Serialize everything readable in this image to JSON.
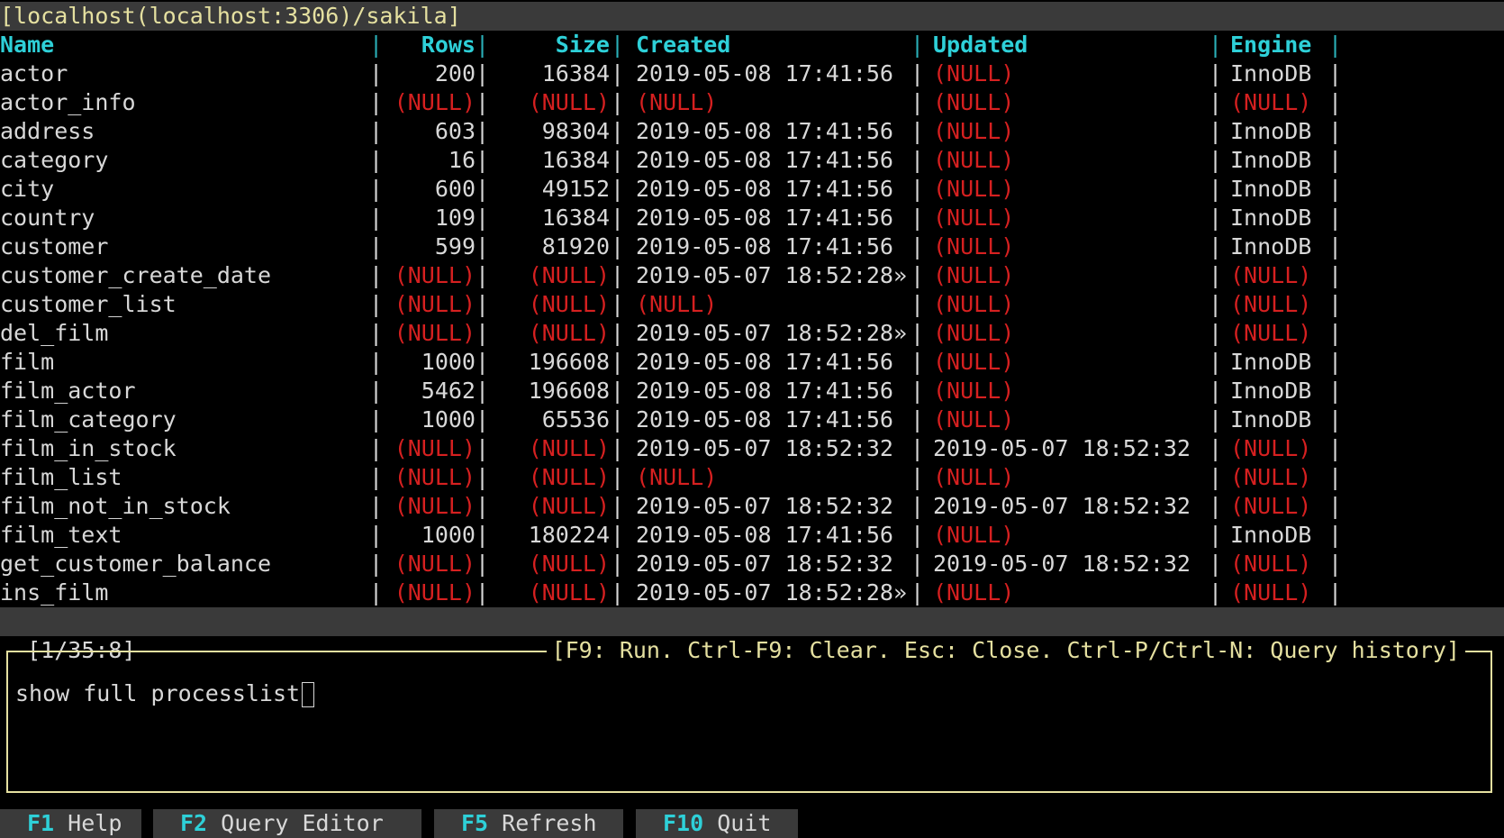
{
  "window": {
    "title": "[localhost(localhost:3306)/sakila]"
  },
  "table": {
    "separator": "|",
    "overflow_marker": "»",
    "columns": [
      "Name",
      "Rows",
      "Size",
      "Created",
      "Updated",
      "Engine"
    ],
    "rows": [
      [
        "actor",
        "200",
        "16384",
        "2019-05-08 17:41:56",
        "(NULL)",
        "InnoDB"
      ],
      [
        "actor_info",
        "(NULL)",
        "(NULL)",
        "(NULL)",
        "(NULL)",
        "(NULL)"
      ],
      [
        "address",
        "603",
        "98304",
        "2019-05-08 17:41:56",
        "(NULL)",
        "InnoDB"
      ],
      [
        "category",
        "16",
        "16384",
        "2019-05-08 17:41:56",
        "(NULL)",
        "InnoDB"
      ],
      [
        "city",
        "600",
        "49152",
        "2019-05-08 17:41:56",
        "(NULL)",
        "InnoDB"
      ],
      [
        "country",
        "109",
        "16384",
        "2019-05-08 17:41:56",
        "(NULL)",
        "InnoDB"
      ],
      [
        "customer",
        "599",
        "81920",
        "2019-05-08 17:41:56",
        "(NULL)",
        "InnoDB"
      ],
      [
        "customer_create_date",
        "(NULL)",
        "(NULL)",
        "2019-05-07 18:52:28»",
        "(NULL)",
        "(NULL)"
      ],
      [
        "customer_list",
        "(NULL)",
        "(NULL)",
        "(NULL)",
        "(NULL)",
        "(NULL)"
      ],
      [
        "del_film",
        "(NULL)",
        "(NULL)",
        "2019-05-07 18:52:28»",
        "(NULL)",
        "(NULL)"
      ],
      [
        "film",
        "1000",
        "196608",
        "2019-05-08 17:41:56",
        "(NULL)",
        "InnoDB"
      ],
      [
        "film_actor",
        "5462",
        "196608",
        "2019-05-08 17:41:56",
        "(NULL)",
        "InnoDB"
      ],
      [
        "film_category",
        "1000",
        "65536",
        "2019-05-08 17:41:56",
        "(NULL)",
        "InnoDB"
      ],
      [
        "film_in_stock",
        "(NULL)",
        "(NULL)",
        "2019-05-07 18:52:32",
        "2019-05-07 18:52:32",
        "(NULL)"
      ],
      [
        "film_list",
        "(NULL)",
        "(NULL)",
        "(NULL)",
        "(NULL)",
        "(NULL)"
      ],
      [
        "film_not_in_stock",
        "(NULL)",
        "(NULL)",
        "2019-05-07 18:52:32",
        "2019-05-07 18:52:32",
        "(NULL)"
      ],
      [
        "film_text",
        "1000",
        "180224",
        "2019-05-08 17:41:56",
        "(NULL)",
        "InnoDB"
      ],
      [
        "get_customer_balance",
        "(NULL)",
        "(NULL)",
        "2019-05-07 18:52:32",
        "2019-05-07 18:52:32",
        "(NULL)"
      ],
      [
        "ins_film",
        "(NULL)",
        "(NULL)",
        "2019-05-07 18:52:28»",
        "(NULL)",
        "(NULL)"
      ]
    ]
  },
  "status": {
    "position": "[1/35:8]"
  },
  "query_editor": {
    "title": "[F9: Run. Ctrl-F9: Clear. Esc: Close. Ctrl-P/Ctrl-N: Query history]",
    "value": "show full processlist"
  },
  "footer": {
    "keys": [
      {
        "key": "F1",
        "label": " Help"
      },
      {
        "key": "F2",
        "label": " Query Editor"
      },
      {
        "key": "F5",
        "label": " Refresh"
      },
      {
        "key": "F10",
        "label": " Quit"
      }
    ]
  },
  "colors": {
    "header": "#2ed0d8",
    "null": "#d62020",
    "title": "#e5e0a0",
    "bar": "#3a3a3a",
    "text": "#d8d8d8"
  }
}
